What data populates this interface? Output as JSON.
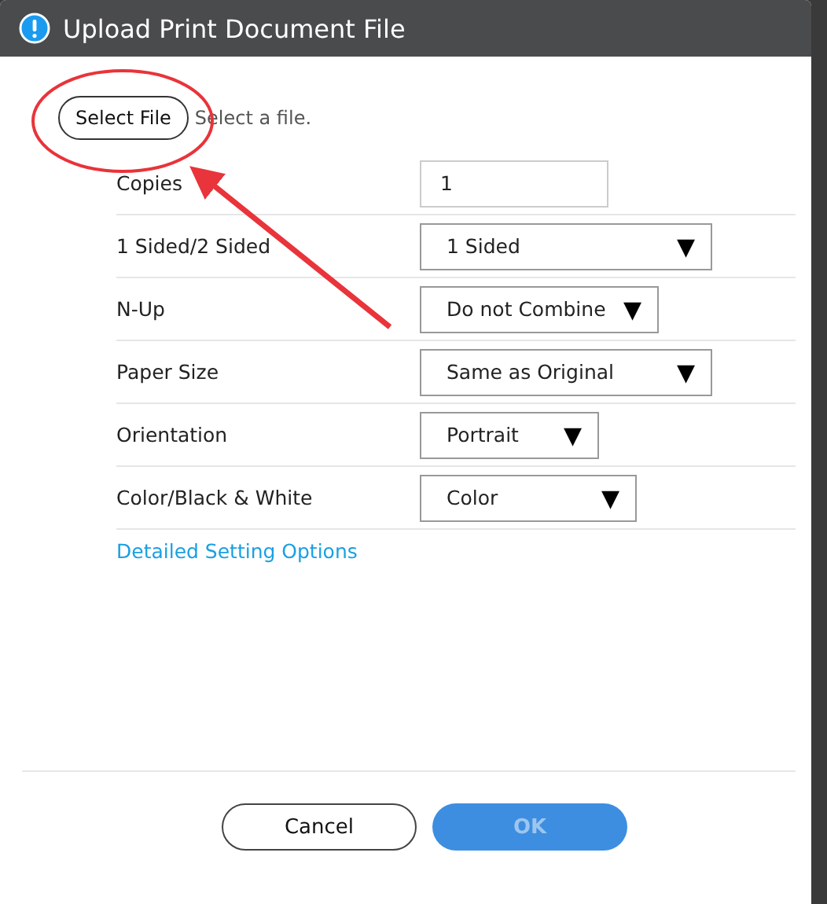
{
  "window": {
    "title": "Upload Print Document File"
  },
  "file": {
    "button": "Select File",
    "hint": "Select a file."
  },
  "settings": [
    {
      "label": "Copies",
      "kind": "input",
      "value": "1"
    },
    {
      "label": "1 Sided/2 Sided",
      "kind": "select",
      "value": "1 Sided",
      "arrow": "▼"
    },
    {
      "label": "N-Up",
      "kind": "select",
      "value": "Do not Combine",
      "arrow": "▼"
    },
    {
      "label": "Paper Size",
      "kind": "select",
      "value": "Same as Original",
      "arrow": "▼"
    },
    {
      "label": "Orientation",
      "kind": "select",
      "value": "Portrait",
      "arrow": "▼"
    },
    {
      "label": "Color/Black & White",
      "kind": "select",
      "value": "Color",
      "arrow": "▼"
    }
  ],
  "link": "Detailed Setting Options",
  "buttons": [
    {
      "label": "Cancel",
      "kind": "secondary",
      "disabled": false
    },
    {
      "label": "OK",
      "kind": "primary",
      "disabled": true
    }
  ]
}
